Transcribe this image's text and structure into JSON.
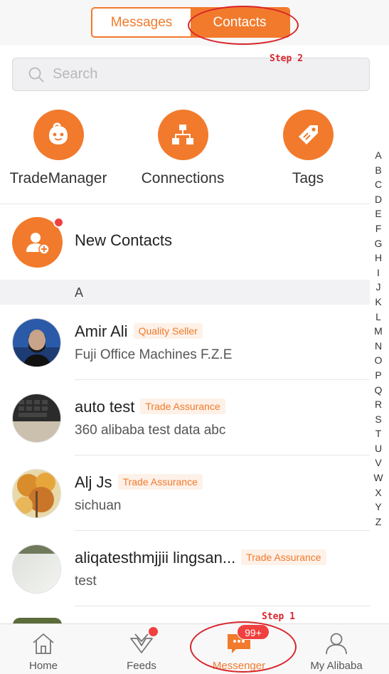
{
  "tabs": {
    "messages": "Messages",
    "contacts": "Contacts",
    "active": "Contacts"
  },
  "search": {
    "placeholder": "Search"
  },
  "shortcuts": [
    {
      "label": "TradeManager",
      "icon": "trademanager-icon"
    },
    {
      "label": "Connections",
      "icon": "connections-icon"
    },
    {
      "label": "Tags",
      "icon": "tag-icon"
    }
  ],
  "new_contacts": {
    "label": "New Contacts"
  },
  "section_letter": "A",
  "contacts": [
    {
      "name": "Amir Ali",
      "badge": "Quality Seller",
      "subtitle": "Fuji Office Machines F.Z.E"
    },
    {
      "name": "auto test",
      "badge": "Trade Assurance",
      "subtitle": "360 alibaba test data abc"
    },
    {
      "name": "Alj Js",
      "badge": "Trade Assurance",
      "subtitle": "sichuan"
    },
    {
      "name": "aliqatesthmjjii lingsan...",
      "badge": "Trade Assurance",
      "subtitle": "test"
    }
  ],
  "alphabet": [
    "A",
    "B",
    "C",
    "D",
    "E",
    "F",
    "G",
    "H",
    "I",
    "J",
    "K",
    "L",
    "M",
    "N",
    "O",
    "P",
    "Q",
    "R",
    "S",
    "T",
    "U",
    "V",
    "W",
    "X",
    "Y",
    "Z"
  ],
  "bottom_nav": {
    "home": "Home",
    "feeds": "Feeds",
    "messenger": "Messenger",
    "my_alibaba": "My Alibaba",
    "messenger_badge": "99+"
  },
  "annotations": {
    "step1": "Step 1",
    "step2": "Step 2"
  },
  "colors": {
    "accent": "#f27a2c",
    "alert": "#f04040",
    "annotation": "#d8242b"
  }
}
